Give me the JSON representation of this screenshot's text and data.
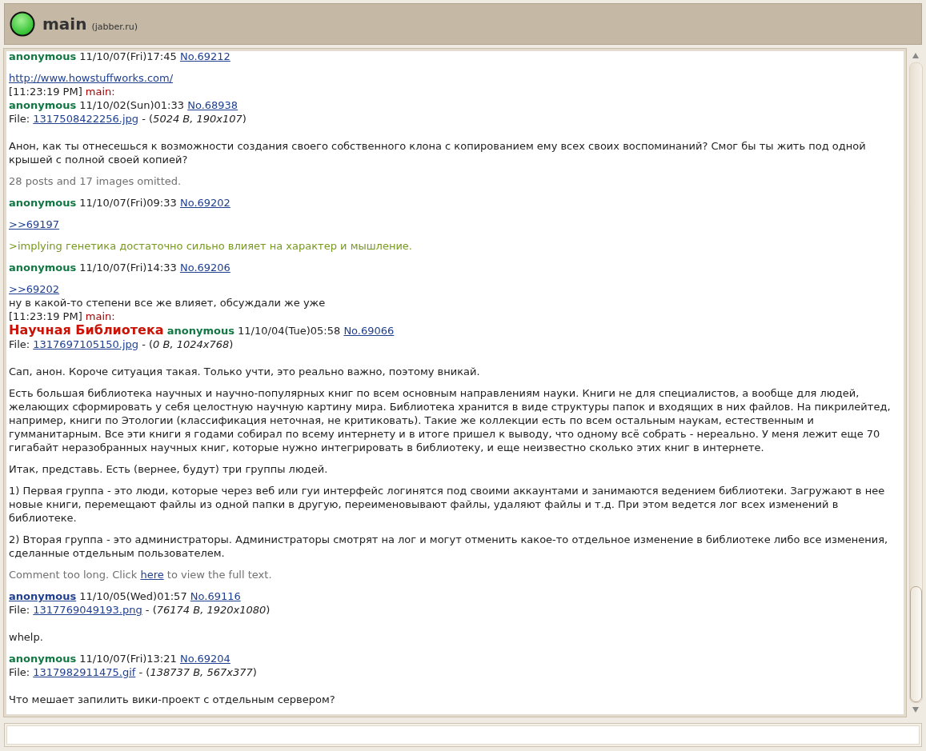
{
  "window": {
    "title": "main",
    "server": "(jabber.ru)"
  },
  "blocks": [
    {
      "lines": [
        {
          "kind": "header",
          "name": "anonymous",
          "name_link": false,
          "date": "11/10/07(Fri)17:45",
          "number": "No.69212"
        }
      ]
    },
    {
      "lines": [
        {
          "kind": "link",
          "text": "http://www.howstuffworks.com/"
        },
        {
          "kind": "timestamp",
          "time": "[11:23:19 PM]",
          "nick": "main:"
        },
        {
          "kind": "header",
          "name": "anonymous",
          "name_link": false,
          "date": "11/10/02(Sun)01:33",
          "number": "No.68938"
        },
        {
          "kind": "file",
          "label": "File:",
          "filename": "1317508422256.jpg",
          "info": "- (*5024 B, 190x107*)"
        }
      ]
    },
    {
      "lines": [
        {
          "kind": "text",
          "text": "Анон, как ты отнесешься к возможности создания своего собственного клона с копированием ему всех своих воспоминаний? Смог бы ты жить под одной крышей с полной своей копией?"
        }
      ]
    },
    {
      "lines": [
        {
          "kind": "omitted",
          "text": "28 posts and 17 images omitted."
        }
      ]
    },
    {
      "lines": [
        {
          "kind": "header",
          "name": "anonymous",
          "name_link": false,
          "date": "11/10/07(Fri)09:33",
          "number": "No.69202"
        }
      ]
    },
    {
      "lines": [
        {
          "kind": "link",
          "text": ">>69197"
        }
      ]
    },
    {
      "lines": [
        {
          "kind": "greentext",
          "text": ">implying генетика достаточно сильно влияет на характер и мышление."
        }
      ]
    },
    {
      "lines": [
        {
          "kind": "header",
          "name": "anonymous",
          "name_link": false,
          "date": "11/10/07(Fri)14:33",
          "number": "No.69206"
        }
      ]
    },
    {
      "lines": [
        {
          "kind": "link",
          "text": ">>69202"
        },
        {
          "kind": "text",
          "text": "ну в какой-то степени все же влияет, обсуждали же уже"
        },
        {
          "kind": "timestamp",
          "time": "[11:23:19 PM]",
          "nick": "main:"
        },
        {
          "kind": "header",
          "subject": "Научная Библиотека",
          "name": "anonymous",
          "name_link": false,
          "date": "11/10/04(Tue)05:58",
          "number": "No.69066"
        },
        {
          "kind": "file",
          "label": "File:",
          "filename": "1317697105150.jpg",
          "info": "- (*0 B, 1024x768*)"
        }
      ]
    },
    {
      "lines": [
        {
          "kind": "text",
          "text": "Сап, анон. Короче ситуация такая. Только учти, это реально важно, поэтому вникай."
        }
      ]
    },
    {
      "lines": [
        {
          "kind": "text",
          "text": "Есть большая библиотека научных и научно-популярных книг по всем основным направлениям науки. Книги не для специалистов, а вообще для людей, желающих сформировать у себя целостную научную картину мира. Библиотека хранится в виде структуры папок и входящих в них файлов. На пикрилейтед, например, книги по Этологии (классификация неточная, не критиковать). Такие же коллекции есть по всем остальным наукам, естественным и гумманитарным. Все эти книги я годами собирал по всему интернету и в итоге пришел к выводу, что одному всё собрать - нереально. У меня лежит еще 70 гигабайт неразобранных научных книг, которые нужно интегрировать в библиотеку, и еще неизвестно сколько этих книг в интернете."
        }
      ]
    },
    {
      "lines": [
        {
          "kind": "text",
          "text": "Итак, представь. Есть (вернее, будут) три группы людей."
        }
      ]
    },
    {
      "lines": [
        {
          "kind": "text",
          "text": "1) Первая группа - это люди, которые через веб или гуи интерфейс логинятся под своими аккаунтами и занимаются ведением библиотеки. Загружают в нее новые книги, перемещают файлы из одной папки в другую, переименовывают файлы, удаляют файлы и т.д. При этом ведется лог всех изменений в библиотеке."
        }
      ]
    },
    {
      "lines": [
        {
          "kind": "text",
          "text": "2) Вторая группа - это администраторы. Администраторы смотрят на лог и могут отменить какое-то отдельное изменение в библиотеке либо все изменения, сделанные отдельным пользователем."
        }
      ]
    },
    {
      "lines": [
        {
          "kind": "truncated",
          "before": "Comment too long. Click",
          "link": "here",
          "after": "to view the full text."
        }
      ]
    },
    {
      "lines": [
        {
          "kind": "header",
          "name": "anonymous",
          "name_link": true,
          "date": "11/10/05(Wed)01:57",
          "number": "No.69116"
        },
        {
          "kind": "file",
          "label": "File:",
          "filename": "1317769049193.png",
          "info": "- (*76174 B, 1920x1080*)"
        }
      ]
    },
    {
      "lines": [
        {
          "kind": "text",
          "text": "whelp."
        }
      ]
    },
    {
      "lines": [
        {
          "kind": "header",
          "name": "anonymous",
          "name_link": false,
          "date": "11/10/07(Fri)13:21",
          "number": "No.69204"
        },
        {
          "kind": "file",
          "label": "File:",
          "filename": "1317982911475.gif",
          "info": "- (*138737 B, 567x377*)"
        }
      ]
    },
    {
      "lines": [
        {
          "kind": "text",
          "text": "Что мешает запилить вики-проект с отдельным сервером?"
        }
      ]
    }
  ]
}
